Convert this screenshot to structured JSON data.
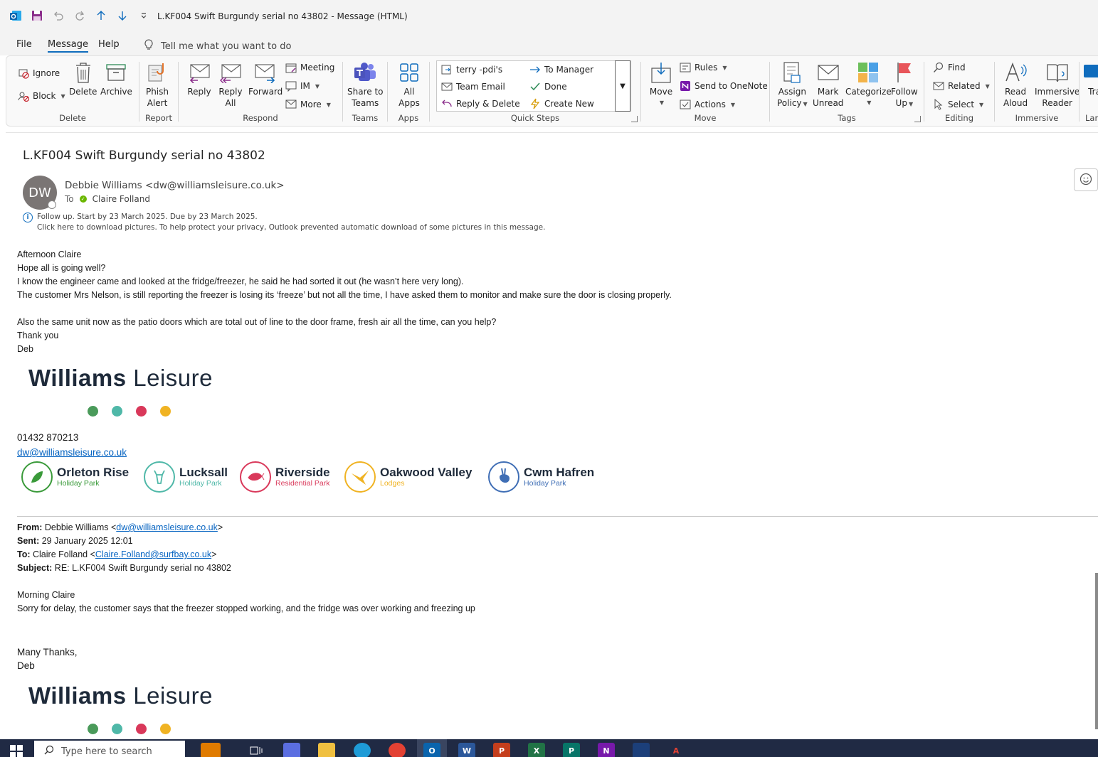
{
  "window": {
    "title": "L.KF004  Swift Burgundy serial no 43802  -  Message (HTML)"
  },
  "menu": {
    "tabs": [
      "File",
      "Message",
      "Help"
    ],
    "tell_me": "Tell me what you want to do"
  },
  "ribbon": {
    "delete_group": {
      "label": "Delete",
      "ignore": "Ignore",
      "block": "Block",
      "delete": "Delete",
      "archive": "Archive"
    },
    "report_group": {
      "label": "Report",
      "phish_line1": "Phish",
      "phish_line2": "Alert"
    },
    "respond_group": {
      "label": "Respond",
      "reply": "Reply",
      "reply_all_line1": "Reply",
      "reply_all_line2": "All",
      "forward": "Forward",
      "meeting": "Meeting",
      "im": "IM",
      "more": "More"
    },
    "teams_group": {
      "label": "Teams",
      "share_line1": "Share to",
      "share_line2": "Teams"
    },
    "apps_group": {
      "label": "Apps",
      "all_line1": "All",
      "all_line2": "Apps"
    },
    "quick_steps": {
      "label": "Quick Steps",
      "items": [
        "terry -pdi's",
        "To Manager",
        "Team Email",
        "Done",
        "Reply & Delete",
        "Create New"
      ]
    },
    "move_group": {
      "label": "Move",
      "move": "Move",
      "rules": "Rules",
      "onenote": "Send to OneNote",
      "actions": "Actions"
    },
    "tags_group": {
      "label": "Tags",
      "assign_line1": "Assign",
      "assign_line2": "Policy",
      "mark_line1": "Mark",
      "mark_line2": "Unread",
      "categorize": "Categorize",
      "follow_line1": "Follow",
      "follow_line2": "Up"
    },
    "editing_group": {
      "label": "Editing",
      "find": "Find",
      "related": "Related",
      "select": "Select"
    },
    "immersive_group": {
      "label": "Immersive",
      "read_line1": "Read",
      "read_line2": "Aloud",
      "imm_line1": "Immersive",
      "imm_line2": "Reader"
    },
    "language_group": {
      "label": "Lan",
      "translate": "Tra"
    }
  },
  "message": {
    "subject": "L.KF004  Swift Burgundy serial no 43802",
    "avatar_initials": "DW",
    "sender": "Debbie Williams <dw@williamsleisure.co.uk>",
    "to_label": "To",
    "to_name": "Claire Folland",
    "info_line1": "Follow up.  Start by 23 March 2025.  Due by 23 March 2025.",
    "info_line2": "Click here to download pictures. To help protect your privacy, Outlook prevented automatic download of some pictures in this message.",
    "body": [
      "Afternoon Claire",
      "Hope all is going well?",
      "I know the engineer came and looked at the fridge/freezer, he said he had sorted it out (he wasn’t here very long).",
      "The customer Mrs Nelson, is still reporting the freezer is losing its ‘freeze’ but not all the time, I have asked them to monitor and make sure the door is closing properly.",
      "",
      "Also the same unit now as the patio doors which are total out of line to the door frame, fresh air all the time, can you help?",
      "Thank you",
      "Deb"
    ],
    "logo_bold": "Williams",
    "logo_light": "Leisure",
    "phone": "01432 870213",
    "email": "dw@williamsleisure.co.uk",
    "parks": [
      {
        "name": "Orleton Rise",
        "sub": "Holiday Park",
        "color": "#3a9a3a"
      },
      {
        "name": "Lucksall",
        "sub": "Holiday Park",
        "color": "#4fb8a8"
      },
      {
        "name": "Riverside",
        "sub": "Residential Park",
        "color": "#d9385a"
      },
      {
        "name": "Oakwood Valley",
        "sub": "Lodges",
        "color": "#f0b323"
      },
      {
        "name": "Cwm Hafren",
        "sub": "Holiday Park",
        "color": "#3f6eb5"
      }
    ],
    "quoted": {
      "from_label": "From:",
      "from_name": "Debbie Williams <",
      "from_email": "dw@williamsleisure.co.uk",
      "sent_label": "Sent:",
      "sent": "29 January 2025 12:01",
      "to_label": "To:",
      "to_name": "Claire Folland <",
      "to_email": "Claire.Folland@surfbay.co.uk",
      "subject_label": "Subject:",
      "subject": "RE: L.KF004 Swift Burgundy serial no 43802",
      "body": [
        "Morning Claire",
        "Sorry for delay, the customer says that the freezer stopped working, and the fridge was over working and freezing up",
        "",
        "",
        "Many Thanks,",
        "Deb"
      ]
    }
  },
  "taskbar": {
    "search_placeholder": "Type here to search"
  },
  "colors": {
    "accent": "#0f6cbd",
    "dot_green": "#4a9a5a",
    "dot_teal": "#4fb8a8",
    "dot_red": "#d9385a",
    "dot_yellow": "#f0b323"
  }
}
